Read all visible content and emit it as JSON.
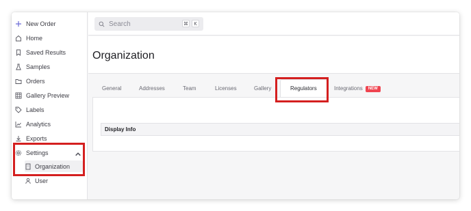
{
  "sidebar": {
    "items": [
      {
        "label": "New Order",
        "icon": "plus-icon"
      },
      {
        "label": "Home",
        "icon": "home-icon"
      },
      {
        "label": "Saved Results",
        "icon": "bookmark-icon"
      },
      {
        "label": "Samples",
        "icon": "flask-icon"
      },
      {
        "label": "Orders",
        "icon": "folder-icon"
      },
      {
        "label": "Gallery Preview",
        "icon": "grid-icon"
      },
      {
        "label": "Labels",
        "icon": "tag-icon"
      },
      {
        "label": "Analytics",
        "icon": "chart-icon"
      },
      {
        "label": "Exports",
        "icon": "download-icon"
      },
      {
        "label": "Settings",
        "icon": "gear-icon",
        "expanded": true
      }
    ],
    "sub_items": [
      {
        "label": "Organization",
        "icon": "building-icon",
        "active": true
      },
      {
        "label": "User",
        "icon": "user-icon"
      }
    ]
  },
  "search": {
    "placeholder": "Search",
    "shortcut_keys": [
      "⌘",
      "K"
    ]
  },
  "header": {
    "title": "Organization"
  },
  "tabs": [
    {
      "label": "General"
    },
    {
      "label": "Addresses"
    },
    {
      "label": "Team"
    },
    {
      "label": "Licenses"
    },
    {
      "label": "Gallery"
    },
    {
      "label": "Regulators",
      "active": true
    },
    {
      "label": "Integrations",
      "badge": "NEW"
    }
  ],
  "content": {
    "section_title": "Display Info"
  },
  "colors": {
    "highlight": "#d41f1f",
    "badge": "#ef4450",
    "accent": "#6b6bd6"
  }
}
